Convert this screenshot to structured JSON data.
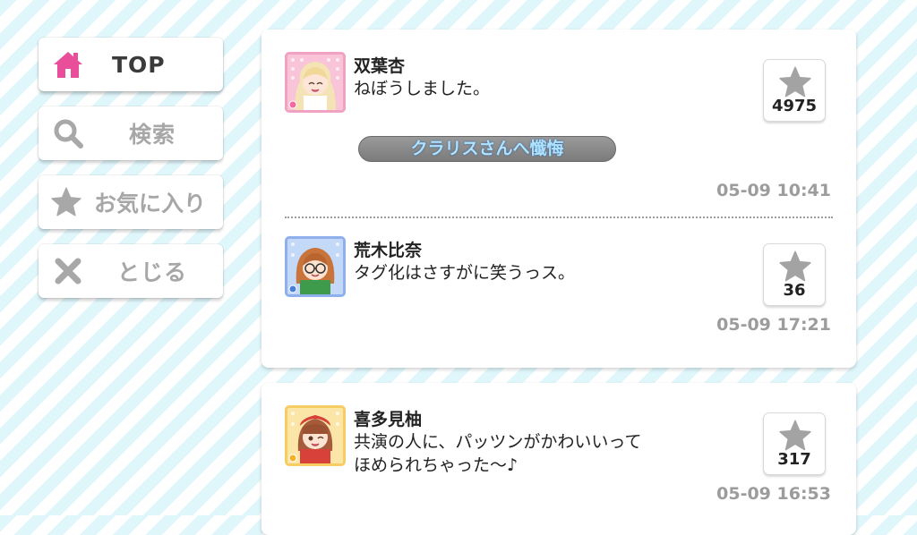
{
  "nav": {
    "items": [
      {
        "label": "TOP",
        "icon": "home-icon"
      },
      {
        "label": "検索",
        "icon": "search-icon"
      },
      {
        "label": "お気に入り",
        "icon": "star-icon"
      },
      {
        "label": "とじる",
        "icon": "close-icon"
      }
    ],
    "active_color": "#e84e9a",
    "inactive_icon_color": "#a8a8a8"
  },
  "posts": [
    {
      "name": "双葉杏",
      "message": "ねぼうしました。",
      "likes": "4975",
      "time": "05-09 10:41",
      "tag": "クラリスさんへ懺悔",
      "avatar_type": "cute"
    },
    {
      "name": "荒木比奈",
      "message": "タグ化はさすがに笑うっス。",
      "likes": "36",
      "time": "05-09 17:21",
      "avatar_type": "cool"
    },
    {
      "name": "喜多見柚",
      "message_line1": "共演の人に、パッツンがかわいいって",
      "message_line2": "ほめられちゃった〜♪",
      "likes": "317",
      "time": "05-09 16:53",
      "avatar_type": "passion"
    }
  ]
}
